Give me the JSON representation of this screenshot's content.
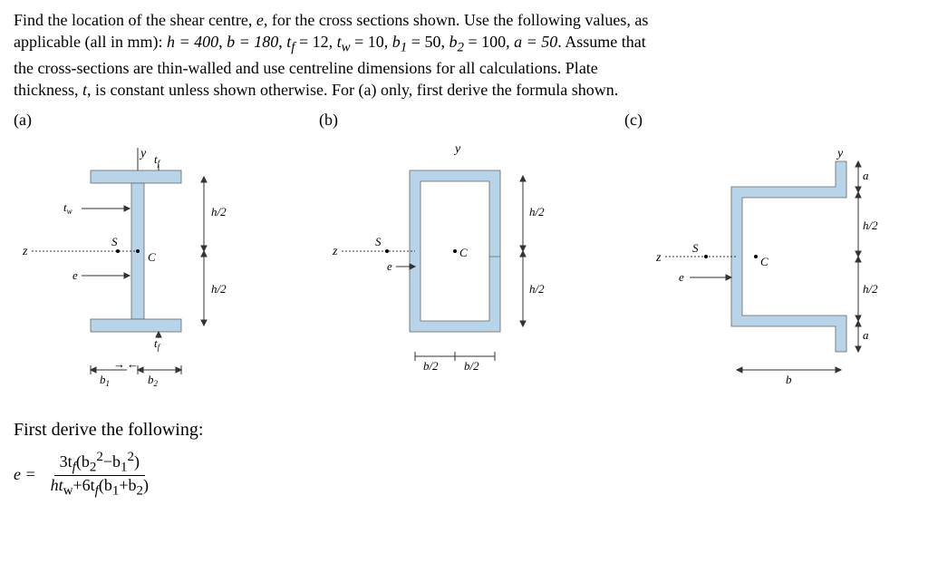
{
  "problem": {
    "line1": "Find the location of the shear centre, ",
    "var_e": "e",
    "line1b": ", for the cross sections shown. Use the following values, as",
    "line2": "applicable (all in mm): ",
    "val_h": "h = 400",
    "val_b": "b = 180",
    "val_tf": " = 12",
    "val_tw": " = 10",
    "val_b1": " = 50",
    "val_b2": " = 100",
    "val_a": "a = 50",
    "line2end": ". Assume that",
    "line3": "the cross-sections are thin-walled and use centreline dimensions for all calculations. Plate",
    "line4": "thickness, ",
    "var_t": "t",
    "line4b": ", is constant unless shown otherwise. For (a) only, first derive the formula shown."
  },
  "labels": {
    "a": "(a)",
    "b": "(b)",
    "c": "(c)"
  },
  "dim": {
    "y": "y",
    "z": "z",
    "tf": "t",
    "tf_sub": "f",
    "tw": "t",
    "tw_sub": "w",
    "h2": "h/2",
    "b2": "b/2",
    "b1": "b",
    "b1_sub": "1",
    "b2w": "b",
    "b2_sub": "2",
    "S": "S",
    "C": "C",
    "e": "e",
    "a": "a",
    "b": "b"
  },
  "derive": {
    "text": "First derive the following:",
    "lhs": "e =",
    "num_a": "3t",
    "num_f": "f",
    "num_paren_open": "(b",
    "num_sub2": "2",
    "num_sq": "2",
    "num_minus": "−b",
    "num_sub1": "1",
    "num_paren_close": ")",
    "den_a": "ht",
    "den_w": "w",
    "den_b": "+6t",
    "den_f": "f",
    "den_c": "(b",
    "den_1": "1",
    "den_d": "+b",
    "den_2": "2",
    "den_e": ")"
  }
}
